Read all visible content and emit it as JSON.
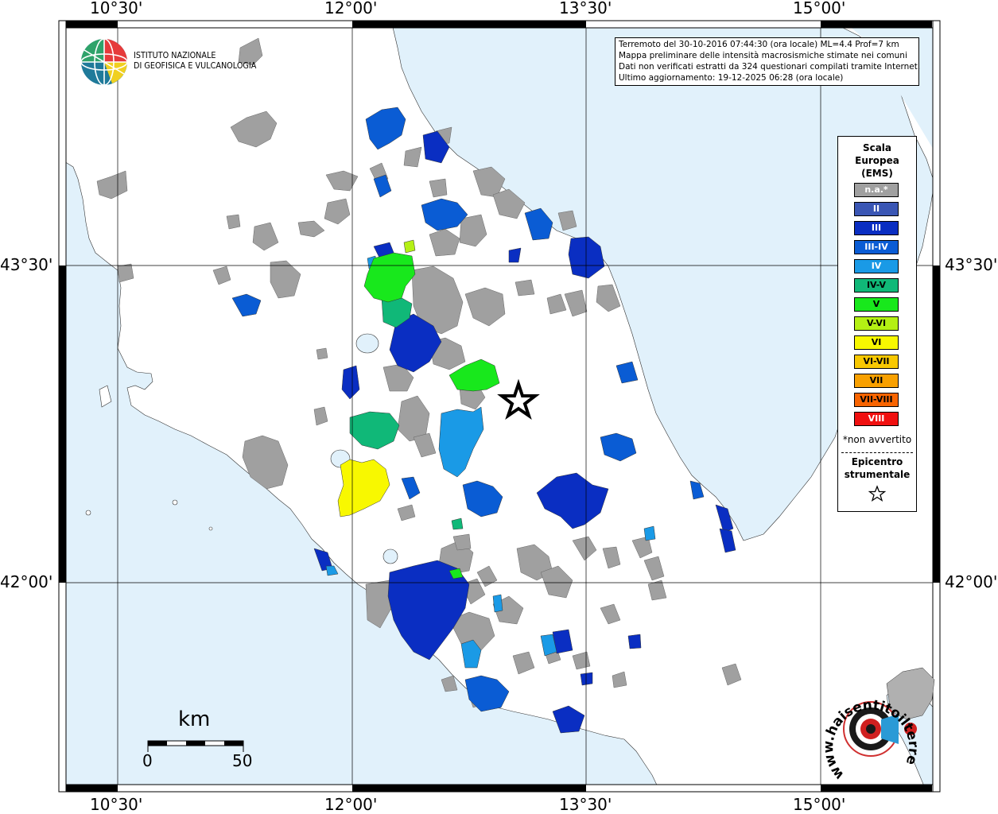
{
  "coordinates": {
    "top_labels": [
      "10°30'",
      "12°00'",
      "13°30'",
      "15°00'"
    ],
    "bottom_labels": [
      "10°30'",
      "12°00'",
      "13°30'",
      "15°00'"
    ],
    "left_labels": [
      "43°30'",
      "42°00'"
    ],
    "right_labels": [
      "43°30'",
      "42°00'"
    ]
  },
  "info": {
    "line1": "Terremoto del 30-10-2016 07:44:30 (ora locale) ML=4.4 Prof=7 km",
    "line2": "Mappa preliminare delle intensità macrosismiche stimate nei comuni",
    "line3": "Dati non verificati estratti da 324 questionari compilati tramite Internet.",
    "line4": "Ultimo aggiornamento: 19-12-2025 06:28 (ora locale)"
  },
  "ingv": {
    "line1": "ISTITUTO NAZIONALE",
    "line2": "DI GEOFISICA E VULCANOLOGIA"
  },
  "legend": {
    "title1": "Scala",
    "title2": "Europea",
    "title3": "(EMS)",
    "items": [
      {
        "label": "n.a.*",
        "color": "#a0a0a0",
        "text_color": "#ffffff"
      },
      {
        "label": "II",
        "color": "#3a56b4",
        "text_color": "#ffffff"
      },
      {
        "label": "III",
        "color": "#0a2ec2",
        "text_color": "#ffffff"
      },
      {
        "label": "III-IV",
        "color": "#0a5cd4",
        "text_color": "#ffffff"
      },
      {
        "label": "IV",
        "color": "#1a9ae6",
        "text_color": "#ffffff"
      },
      {
        "label": "IV-V",
        "color": "#10b878",
        "text_color": "#000000"
      },
      {
        "label": "V",
        "color": "#18e81c",
        "text_color": "#000000"
      },
      {
        "label": "V-VI",
        "color": "#b4f014",
        "text_color": "#000000"
      },
      {
        "label": "VI",
        "color": "#f8f800",
        "text_color": "#000000"
      },
      {
        "label": "VI-VII",
        "color": "#f8c800",
        "text_color": "#000000"
      },
      {
        "label": "VII",
        "color": "#f8a000",
        "text_color": "#000000"
      },
      {
        "label": "VII-VIII",
        "color": "#f86400",
        "text_color": "#000000"
      },
      {
        "label": "VIII",
        "color": "#f01010",
        "text_color": "#ffffff"
      }
    ],
    "note": "*non avvertito",
    "epicentre1": "Epicentro",
    "epicentre2": "strumentale"
  },
  "scale_bar": {
    "unit": "km",
    "start": "0",
    "end": "50"
  },
  "haisentito_logo": {
    "text": "www.haisentitoilterremoto.it"
  },
  "colors": {
    "sea": "#e1f1fb",
    "land": "#ffffff",
    "grid": "#000000"
  }
}
